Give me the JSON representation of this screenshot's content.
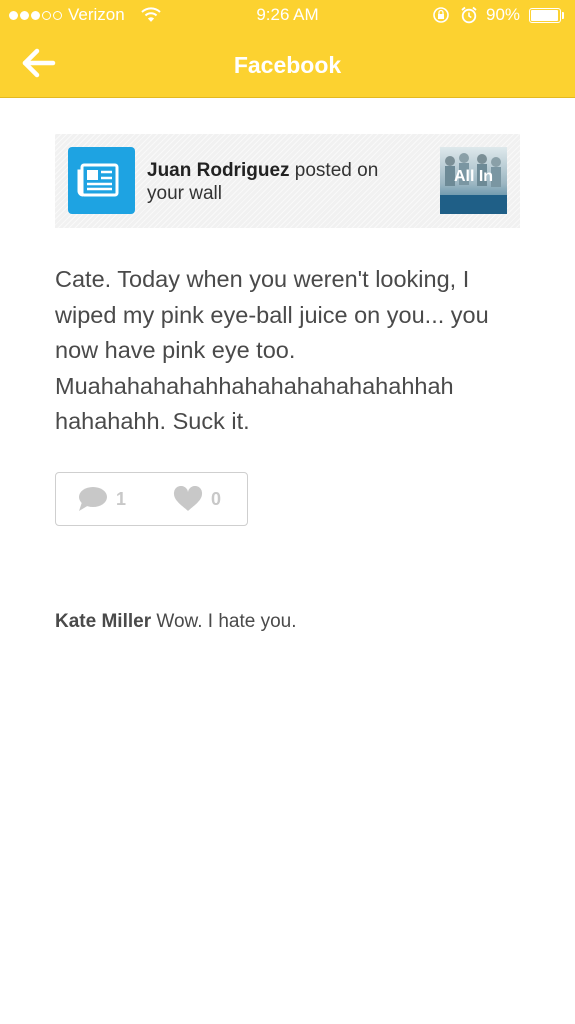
{
  "status_bar": {
    "carrier": "Verizon",
    "time": "9:26 AM",
    "battery_percent_label": "90%",
    "battery_level": 0.9,
    "signal_bars_filled": 3,
    "signal_bars_total": 5
  },
  "nav": {
    "title": "Facebook",
    "back_icon": "arrow-left-icon"
  },
  "notification": {
    "actor_name": "Juan Rodriguez",
    "action_text": "posted on your wall",
    "icon": "newspaper-icon",
    "icon_color": "#1ea3e2",
    "thumbnail_text": "All In"
  },
  "post": {
    "text": "Cate. Today when you weren't looking, I wiped my pink eye-ball juice on you... you now have pink eye too. Muahahahahahhahahahahahahahhah hahahahh. Suck it.",
    "comment_count": "1",
    "like_count": "0",
    "comment_icon": "speech-bubble-icon",
    "like_icon": "heart-icon"
  },
  "comments": [
    {
      "author": "Kate Miller",
      "text": "Wow. I hate you."
    }
  ],
  "colors": {
    "header_bg": "#fcd230",
    "header_text": "#ffffff",
    "body_text": "#4a4a4a",
    "muted_icon": "#c8c8c8"
  }
}
